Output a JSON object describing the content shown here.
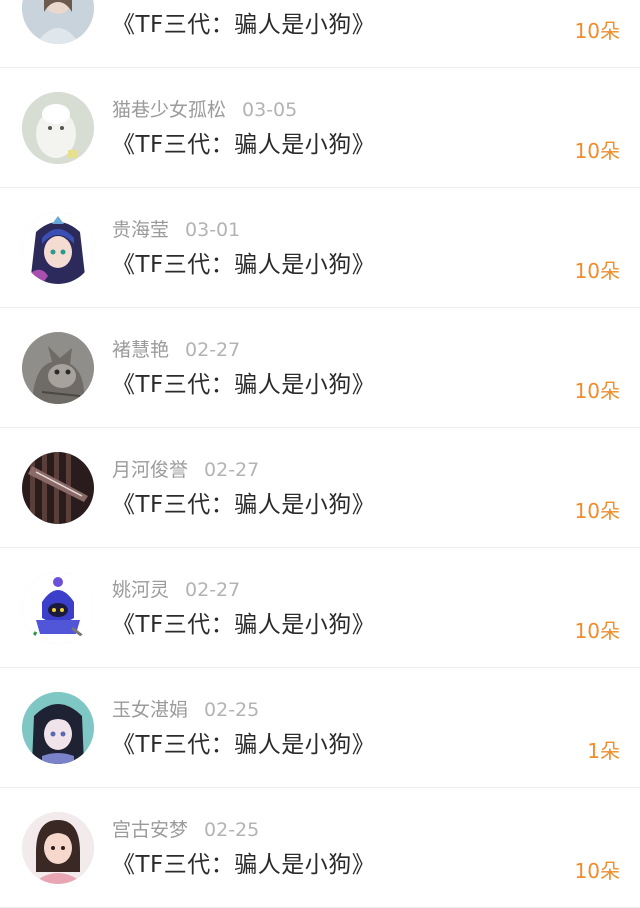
{
  "items": [
    {
      "name": "",
      "date": "",
      "title": "《TF三代：骗人是小狗》",
      "amount": "10朵",
      "avatar": "avatar-girl-photo"
    },
    {
      "name": "猫巷少女孤松",
      "date": "03-05",
      "title": "《TF三代：骗人是小狗》",
      "amount": "10朵",
      "avatar": "avatar-white-llama"
    },
    {
      "name": "贵海莹",
      "date": "03-01",
      "title": "《TF三代：骗人是小狗》",
      "amount": "10朵",
      "avatar": "avatar-anime-girl-blue-hair"
    },
    {
      "name": "褚慧艳",
      "date": "02-27",
      "title": "《TF三代：骗人是小狗》",
      "amount": "10朵",
      "avatar": "avatar-grey-cat"
    },
    {
      "name": "月河俊誉",
      "date": "02-27",
      "title": "《TF三代：骗人是小狗》",
      "amount": "10朵",
      "avatar": "avatar-dark-bars"
    },
    {
      "name": "姚河灵",
      "date": "02-27",
      "title": "《TF三代：骗人是小狗》",
      "amount": "10朵",
      "avatar": "avatar-blue-knight"
    },
    {
      "name": "玉女湛娟",
      "date": "02-25",
      "title": "《TF三代：骗人是小狗》",
      "amount": "1朵",
      "avatar": "avatar-anime-girl-dark"
    },
    {
      "name": "宫古安梦",
      "date": "02-25",
      "title": "《TF三代：骗人是小狗》",
      "amount": "10朵",
      "avatar": "avatar-child-photo"
    }
  ],
  "colors": {
    "amount": "#f08c2a",
    "name": "#9b9b9b",
    "title": "#2b2b2b",
    "divider": "#ededed"
  }
}
